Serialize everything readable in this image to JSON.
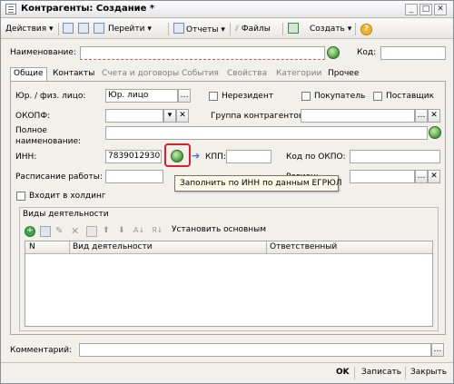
{
  "window": {
    "title": "Контрагенты: Создание *"
  },
  "toolbar": {
    "actions": "Действия",
    "goto": "Перейти",
    "reports": "Отчеты",
    "files": "Файлы",
    "create": "Создать",
    "help": "?"
  },
  "form": {
    "name_label": "Наименование:",
    "name_value": "",
    "code_label": "Код:",
    "code_value": ""
  },
  "tabs": [
    {
      "label": "Общие",
      "state": "active"
    },
    {
      "label": "Контакты",
      "state": "normal"
    },
    {
      "label": "Счета и договоры",
      "state": "disabled"
    },
    {
      "label": "События",
      "state": "disabled"
    },
    {
      "label": "Свойства",
      "state": "disabled"
    },
    {
      "label": "Категории",
      "state": "disabled"
    },
    {
      "label": "Прочее",
      "state": "normal"
    }
  ],
  "general": {
    "legal_label": "Юр. / физ. лицо:",
    "legal_value": "Юр. лицо",
    "nonresident": "Нерезидент",
    "buyer": "Покупатель",
    "supplier": "Поставщик",
    "okopf_label": "ОКОПФ:",
    "okopf_value": "",
    "group_label": "Группа контрагентов:",
    "group_value": "",
    "full_name_label_1": "Полное",
    "full_name_label_2": "наименование:",
    "full_name_value": "",
    "inn_label": "ИНН:",
    "inn_value": "7839012930",
    "kpp_label": "КПП:",
    "kpp_value": "",
    "okpo_label": "Код по ОКПО:",
    "okpo_value": "",
    "schedule_label": "Расписание работы:",
    "schedule_value": "",
    "region_label": "Регион:",
    "region_value": "",
    "holding": "Входит в холдинг"
  },
  "activities": {
    "title": "Виды деятельности",
    "set_main": "Установить основным",
    "columns": [
      "N",
      "Вид деятельности",
      "Ответственный"
    ],
    "rows": []
  },
  "tooltip": {
    "text": "Заполнить по ИНН по данным ЕГРЮЛ"
  },
  "comment": {
    "label": "Комментарий:",
    "value": ""
  },
  "footer": {
    "ok": "OK",
    "save": "Записать",
    "close": "Закрыть"
  },
  "colors": {
    "highlight": "#d8222a",
    "accent": "#4a9a3c"
  }
}
